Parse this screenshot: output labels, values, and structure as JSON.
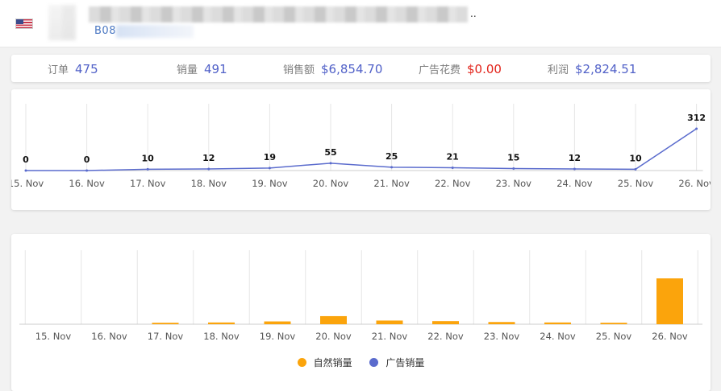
{
  "header": {
    "asin_prefix": "B08",
    "title_ellipsis": "..",
    "flag_icon": "us-flag-icon"
  },
  "stats": [
    {
      "label": "订单",
      "value": "475",
      "highlight": false
    },
    {
      "label": "销量",
      "value": "491",
      "highlight": false
    },
    {
      "label": "销售额",
      "value": "$6,854.70",
      "highlight": false
    },
    {
      "label": "广告花费",
      "value": "$0.00",
      "highlight": true
    },
    {
      "label": "利润",
      "value": "$2,824.51",
      "highlight": false
    }
  ],
  "colors": {
    "accent": "#5161c8",
    "negative": "#e2231a",
    "natural_sales": "#fba40c",
    "ad_sales": "#5a6bcd",
    "grid": "#e6e6e6"
  },
  "chart_data": [
    {
      "type": "line",
      "categories": [
        "15. Nov",
        "16. Nov",
        "17. Nov",
        "18. Nov",
        "19. Nov",
        "20. Nov",
        "21. Nov",
        "22. Nov",
        "23. Nov",
        "24. Nov",
        "25. Nov",
        "26. Nov"
      ],
      "series": [
        {
          "values": [
            0,
            0,
            10,
            12,
            19,
            55,
            25,
            21,
            15,
            12,
            10,
            312
          ]
        }
      ],
      "data_labels": true,
      "grid": "vertical"
    },
    {
      "type": "bar",
      "stacked": true,
      "categories": [
        "15. Nov",
        "16. Nov",
        "17. Nov",
        "18. Nov",
        "19. Nov",
        "20. Nov",
        "21. Nov",
        "22. Nov",
        "23. Nov",
        "24. Nov",
        "25. Nov",
        "26. Nov"
      ],
      "series": [
        {
          "name": "自然销量",
          "values": [
            0,
            0,
            10,
            12,
            19,
            55,
            25,
            21,
            15,
            12,
            10,
            312
          ]
        },
        {
          "name": "广告销量",
          "values": [
            0,
            0,
            0,
            0,
            0,
            0,
            0,
            0,
            0,
            0,
            0,
            0
          ]
        }
      ],
      "legend": "bottom",
      "grid": "vertical"
    }
  ]
}
